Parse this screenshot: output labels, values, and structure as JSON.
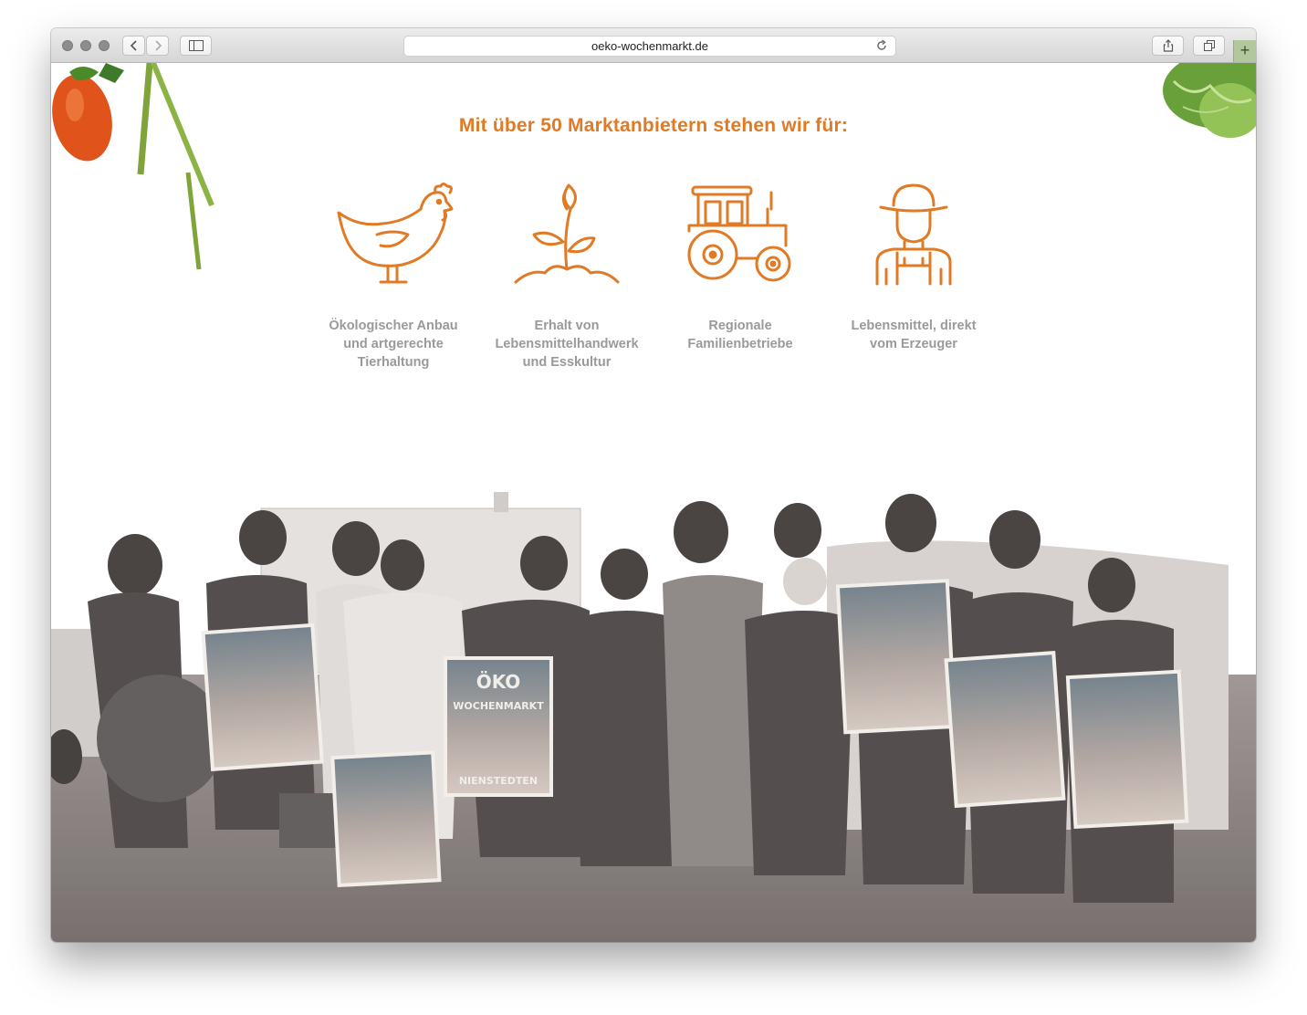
{
  "browser": {
    "url": "oeko-wochenmarkt.de",
    "new_tab_label": "+"
  },
  "page": {
    "headline": "Mit über 50 Marktanbietern stehen wir für:",
    "accent_color": "#e07a25",
    "features": [
      {
        "icon": "chicken-icon",
        "label": "Ökologischer Anbau\nund artgerechte\nTierhaltung"
      },
      {
        "icon": "sprout-icon",
        "label": "Erhalt von\nLebensmittelhandwerk\nund Esskultur"
      },
      {
        "icon": "tractor-icon",
        "label": "Regionale\nFamilienbetriebe"
      },
      {
        "icon": "farmer-icon",
        "label": "Lebensmittel, direkt\nvom Erzeuger"
      }
    ],
    "photo": {
      "poster_text": [
        "ÖKO",
        "WOCHENMARKT",
        "NIENSTEDTEN"
      ]
    }
  }
}
